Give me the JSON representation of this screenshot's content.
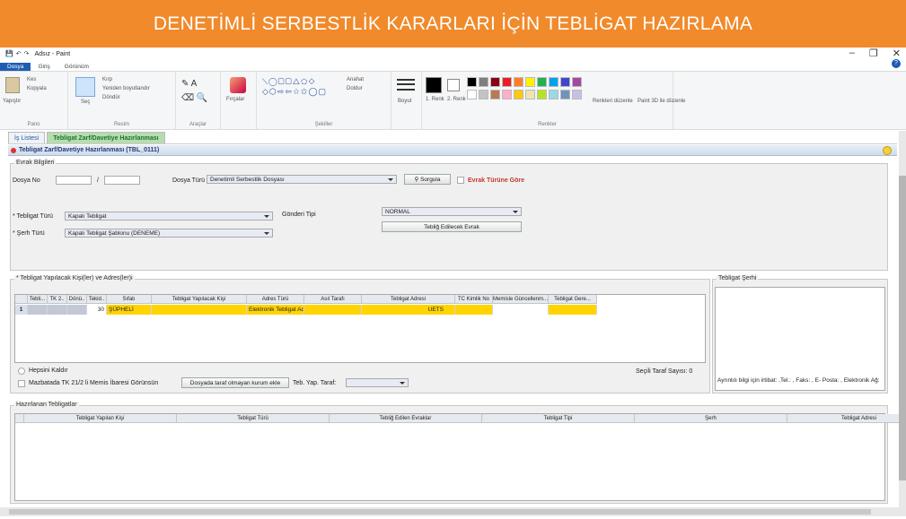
{
  "banner": {
    "title": "DENETİMLİ SERBESTLİK KARARLARI İÇİN TEBLİGAT HAZIRLAMA",
    "color": "#f08a2b"
  },
  "paint": {
    "window_title": "Adsız - Paint",
    "tabs": [
      "Dosya",
      "Giriş",
      "Görünüm"
    ],
    "groups": {
      "pano": {
        "label": "Pano",
        "paste": "Yapıştır",
        "cut": "Kes",
        "copy": "Kopyala"
      },
      "resim": {
        "label": "Resim",
        "select": "Seç",
        "crop": "Kırp",
        "resize": "Yeniden boyutlandır",
        "rotate": "Döndür"
      },
      "araclar": {
        "label": "Araçlar"
      },
      "fircalar": {
        "label": "Fırçalar"
      },
      "sekiller": {
        "label": "Şekiller",
        "outline": "Anahat",
        "fill": "Doldur"
      },
      "boyut": {
        "label": "Boyut"
      },
      "renkler": {
        "label": "Renkler",
        "color1": "1. Renk",
        "color2": "2. Renk",
        "edit": "Renkleri düzenle",
        "paint3d": "Paint 3D ile düzenle"
      }
    },
    "palette": [
      "#000000",
      "#7f7f7f",
      "#880015",
      "#ed1c24",
      "#ff7f27",
      "#fff200",
      "#22b14c",
      "#00a2e8",
      "#3f48cc",
      "#a349a4",
      "#ffffff",
      "#c3c3c3",
      "#b97a57",
      "#ffaec9",
      "#ffc90e",
      "#efe4b0",
      "#b5e61d",
      "#99d9ea",
      "#7092be",
      "#c8bfe7"
    ]
  },
  "app": {
    "tabs": [
      "İş Listesi",
      "Tebligat Zarf/Davetiye Hazırlanması"
    ],
    "form_title": "Tebligat Zarf/Davetiye Hazırlanması (TBL_0111)",
    "evrak": {
      "legend": "Evrak Bilgileri",
      "dosya_no_label": "Dosya No",
      "slash": "/",
      "dosya_turu_label": "Dosya Türü",
      "dosya_turu_value": "Denetimli Serbestlik Dosyası",
      "sorgula": "Sorgula",
      "evrak_turune_gore": "Evrak Türüne Göre",
      "tebligat_turu_label": "* Tebligat Türü",
      "tebligat_turu_value": "Kapalı Tebligat",
      "serh_turu_label": "* Şerh Türü",
      "serh_turu_value": "Kapalı Tebligat Şablonu (DENEME)",
      "gonderi_tipi_label": "Gönderi Tipi",
      "gonderi_tipi_value": "NORMAL",
      "tebliğ_btn": "Tebliğ Edilecek Evrak"
    },
    "kisiler": {
      "legend": "* Tebligat Yapılacak Kişi(ler) ve Adres(ler)i",
      "columns": [
        "Tebli...",
        "TK 2..",
        "Dönü..",
        "Tekid..",
        "Sıfatı",
        "Tebligat Yapılacak Kişi",
        "Adres Türü",
        "Asıl Tarafı",
        "Tebligat Adresi",
        "TC Kimlik No",
        "Memisle Güncellenm...",
        "Tebligat Gere..."
      ],
      "row": {
        "num": "1",
        "tekid": "30",
        "sifat": "ŞÜPHELİ",
        "adres_turu": "Elektronik Tebligat Ad...",
        "adres": "UETS"
      },
      "hepsini_kaldir": "Hepsini Kaldır",
      "mazbata": "Mazbatada TK 21/2 li Memis İbaresi Görünsün",
      "dosyada_btn": "Dosyada taraf olmayan kurum ekle",
      "teb_yap_taraf": "Teb. Yap. Taraf:",
      "secili_taraf": "Seçili Taraf Sayısı: 0"
    },
    "serh": {
      "legend": "Tebligat Şerhi",
      "info": "Ayrıntılı bilgi için irtibat: ,Tel.: , Faks: , E- Posta: , Elektronik Ağ:"
    },
    "hazirlanan": {
      "legend": "Hazırlanan Tebligatlar",
      "columns": [
        "Tebligat Yapılan Kişi",
        "Tebligat Türü",
        "Tebliğ Edilen Evraklar",
        "Tebligat Tipi",
        "Şerh",
        "Tebligat Adresi"
      ]
    }
  }
}
